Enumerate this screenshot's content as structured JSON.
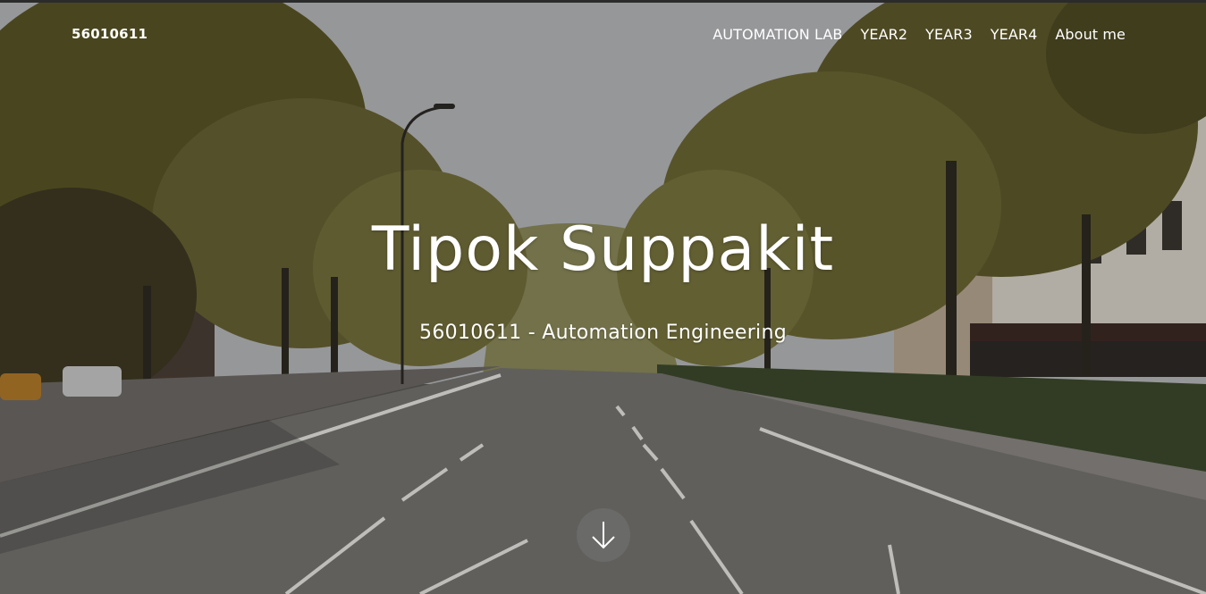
{
  "navbar": {
    "brand": "56010611",
    "links": [
      "AUTOMATION LAB",
      "YEAR2",
      "YEAR3",
      "YEAR4",
      "About me"
    ]
  },
  "hero": {
    "title": "Tipok Suppakit",
    "subtitle": "56010611 - Automation Engineering",
    "scroll_icon": "arrow-down-icon",
    "background_image": "street-with-trees-photo"
  },
  "colors": {
    "text": "#ffffff",
    "scroll_button_bg": "#6e6e6e",
    "sky": "#b9bbbd",
    "foliage": "#6b6a2f",
    "road": "#6e6c6a"
  }
}
